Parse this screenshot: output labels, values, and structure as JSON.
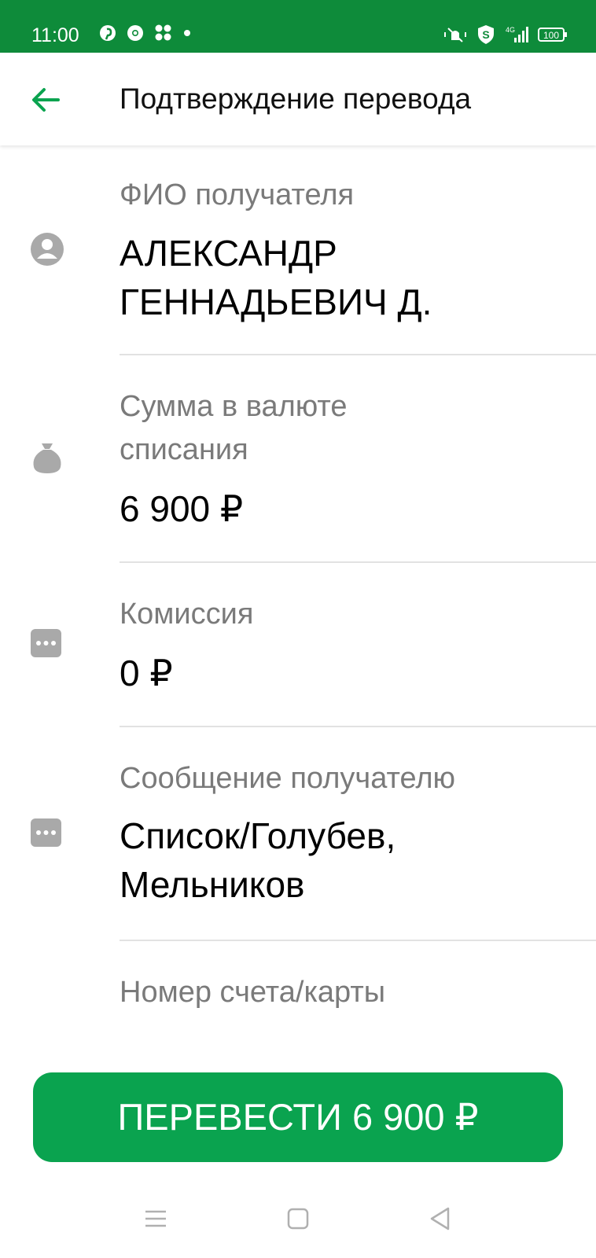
{
  "status_bar": {
    "time": "11:00",
    "icons_left": [
      "pinterest-icon",
      "chrome-icon",
      "app-dots-icon",
      "dot-icon"
    ],
    "icons_right": [
      "mute-vibrate-icon",
      "security-shield-icon",
      "signal-4g-icon",
      "battery-icon"
    ],
    "battery": "100",
    "network": "4G"
  },
  "app_bar": {
    "title": "Подтверждение перевода",
    "back_icon": "arrow-left-icon"
  },
  "fields": [
    {
      "icon": "person-icon",
      "label": "ФИО получателя",
      "value_lines": [
        "АЛЕКСАНДР",
        "ГЕННАДЬЕВИЧ Д."
      ]
    },
    {
      "icon": "money-bag-icon",
      "label_lines": [
        "Сумма в валюте",
        "списания"
      ],
      "value": "6 900 ₽"
    },
    {
      "icon": "ellipsis-icon",
      "label": "Комиссия",
      "value": "0 ₽"
    },
    {
      "icon": "message-icon",
      "label": "Сообщение получателю",
      "value_lines": [
        "Список/Голубев,",
        "Мельников"
      ]
    },
    {
      "label": "Номер счета/карты"
    }
  ],
  "primary_button": {
    "label": "ПЕРЕВЕСТИ 6 900 ₽"
  },
  "nav_bar": {
    "buttons": [
      "menu-icon",
      "home-square-icon",
      "back-triangle-icon"
    ]
  },
  "colors": {
    "status_bar": "#0e8b3a",
    "accent": "#0aa34f",
    "label": "#7a7a7a",
    "icon": "#a9a9a9"
  }
}
